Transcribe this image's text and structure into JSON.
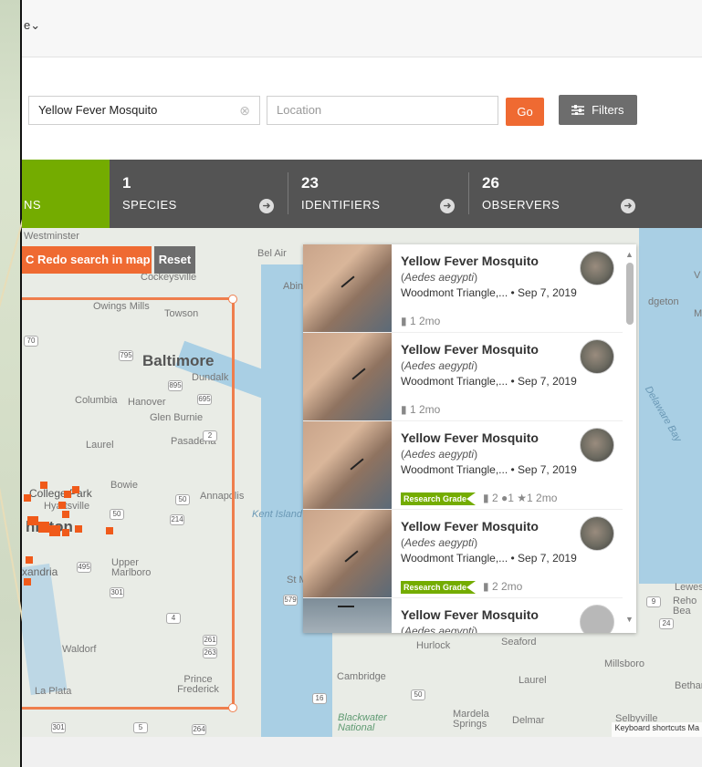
{
  "topbar": {
    "nav_fragment": "e",
    "nav_chevron": "⌄"
  },
  "search": {
    "taxon_value": "Yellow Fever Mosquito",
    "clear_icon": "⊗",
    "location_placeholder": "Location",
    "go_label": "Go",
    "filters_label": "Filters"
  },
  "stats": {
    "observations_label_fragment": "NS",
    "species": {
      "count": "1",
      "label": "SPECIES"
    },
    "identifiers": {
      "count": "23",
      "label": "IDENTIFIERS"
    },
    "observers": {
      "count": "26",
      "label": "OBSERVERS"
    }
  },
  "map": {
    "redo_label": "C Redo search in map",
    "reset_label": "Reset",
    "labels": {
      "westminster": "Westminster",
      "bel_air": "Bel Air",
      "cockeysville": "Cockeysville",
      "abingdon": "Abingo",
      "owings_mills": "Owings Mills",
      "towson": "Towson",
      "baltimore": "Baltimore",
      "dundalk": "Dundalk",
      "columbia": "Columbia",
      "hanover": "Hanover",
      "glen_burnie": "Glen Burnie",
      "laurel": "Laurel",
      "pasadena": "Pasadena",
      "bowie": "Bowie",
      "annapolis": "Annapolis",
      "college_park": "College Park",
      "hyattsville": "Hyattsville",
      "washington": "hinton",
      "alexandria": "xandria",
      "upper_marlboro": "Upper Marlboro",
      "kent_island": "Kent Island",
      "waldorf": "Waldorf",
      "prince_frederick": "Prince Frederick",
      "la_plata": "La Plata",
      "cambridge": "Cambridge",
      "hurlock": "Hurlock",
      "seaford": "Seaford",
      "laurel_de": "Laurel",
      "millsboro": "Millsboro",
      "bethany": "Bethan",
      "selbyville": "Selbyville",
      "mardela_springs": "Mardela Springs",
      "delmar": "Delmar",
      "blackwater": "Blackwater National",
      "lewes": "Lewes",
      "rehoboth": "Reho Bea",
      "edgeton": "dgeton",
      "delaware_bay": "Delaware Bay",
      "st_m": "St M",
      "v_right": "V",
      "m_right": "M"
    },
    "shields": [
      "70",
      "795",
      "695",
      "895",
      "2",
      "50",
      "214",
      "50",
      "495",
      "301",
      "4",
      "261",
      "263",
      "16",
      "50",
      "579",
      "9",
      "24",
      "301",
      "5",
      "264"
    ],
    "attribution": "Keyboard shortcuts   Ma"
  },
  "observations": [
    {
      "common_name": "Yellow Fever Mosquito",
      "scientific_name": "Aedes aegypti",
      "place": "Woodmont Triangle,...",
      "date": "• Sep 7, 2019",
      "meta": "1  2mo",
      "research_grade": false,
      "avatar": "photo"
    },
    {
      "common_name": "Yellow Fever Mosquito",
      "scientific_name": "Aedes aegypti",
      "place": "Woodmont Triangle,...",
      "date": "• Sep 7, 2019",
      "meta": "1  2mo",
      "research_grade": false,
      "avatar": "photo"
    },
    {
      "common_name": "Yellow Fever Mosquito",
      "scientific_name": "Aedes aegypti",
      "place": "Woodmont Triangle,...",
      "date": "• Sep 7, 2019",
      "meta": "2 ●1 ★1  2mo",
      "research_grade": true,
      "avatar": "photo"
    },
    {
      "common_name": "Yellow Fever Mosquito",
      "scientific_name": "Aedes aegypti",
      "place": "Woodmont Triangle,...",
      "date": "• Sep 7, 2019",
      "meta": "2  2mo",
      "research_grade": true,
      "avatar": "photo"
    },
    {
      "common_name": "Yellow Fever Mosquito",
      "scientific_name": "Aedes aegypti",
      "place": "",
      "date": "",
      "meta": "",
      "research_grade": false,
      "avatar": "blank"
    }
  ],
  "research_grade_label": "Research Grade",
  "icons": {
    "clear": "clear-icon",
    "filters": "sliders-icon",
    "arrow": "arrow-right-circle-icon",
    "comment": "comment-icon",
    "star": "star-icon",
    "id": "identification-icon"
  }
}
